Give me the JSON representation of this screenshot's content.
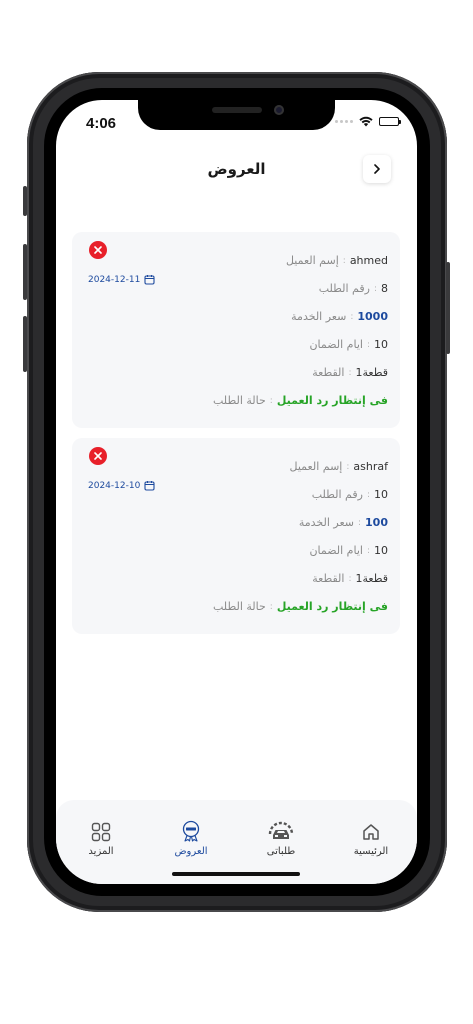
{
  "status_bar": {
    "time": "4:06"
  },
  "header": {
    "title": "العروض"
  },
  "offers": [
    {
      "date": "2024-12-11",
      "fields": [
        {
          "label": "إسم العميل",
          "value": "ahmed",
          "kind": "normal"
        },
        {
          "label": "رقم الطلب",
          "value": "8",
          "kind": "normal"
        },
        {
          "label": "سعر الخدمة",
          "value": "1000",
          "kind": "price"
        },
        {
          "label": "ايام الضمان",
          "value": "10",
          "kind": "normal"
        },
        {
          "label": "القطعة",
          "value": "قطعة1",
          "kind": "normal"
        },
        {
          "label": "حالة الطلب",
          "value": "فى إنتظار رد العميل",
          "kind": "status"
        }
      ]
    },
    {
      "date": "2024-12-10",
      "fields": [
        {
          "label": "إسم العميل",
          "value": "ashraf",
          "kind": "normal"
        },
        {
          "label": "رقم الطلب",
          "value": "10",
          "kind": "normal"
        },
        {
          "label": "سعر الخدمة",
          "value": "100",
          "kind": "price"
        },
        {
          "label": "ايام الضمان",
          "value": "10",
          "kind": "normal"
        },
        {
          "label": "القطعة",
          "value": "قطعة1",
          "kind": "normal"
        },
        {
          "label": "حالة الطلب",
          "value": "فى إنتظار رد العميل",
          "kind": "status"
        }
      ]
    }
  ],
  "separator": ":",
  "tabbar": {
    "items": [
      {
        "label": "الرئيسية",
        "icon": "home-icon",
        "active": false
      },
      {
        "label": "طلباتى",
        "icon": "car-gear-icon",
        "active": false
      },
      {
        "label": "العروض",
        "icon": "offers-badge-icon",
        "active": true
      },
      {
        "label": "المزيد",
        "icon": "grid-icon",
        "active": false
      }
    ]
  },
  "colors": {
    "accent": "#1d4a9e",
    "status_green": "#27a427",
    "danger": "#e8202a",
    "card_bg": "#f6f7f9"
  }
}
